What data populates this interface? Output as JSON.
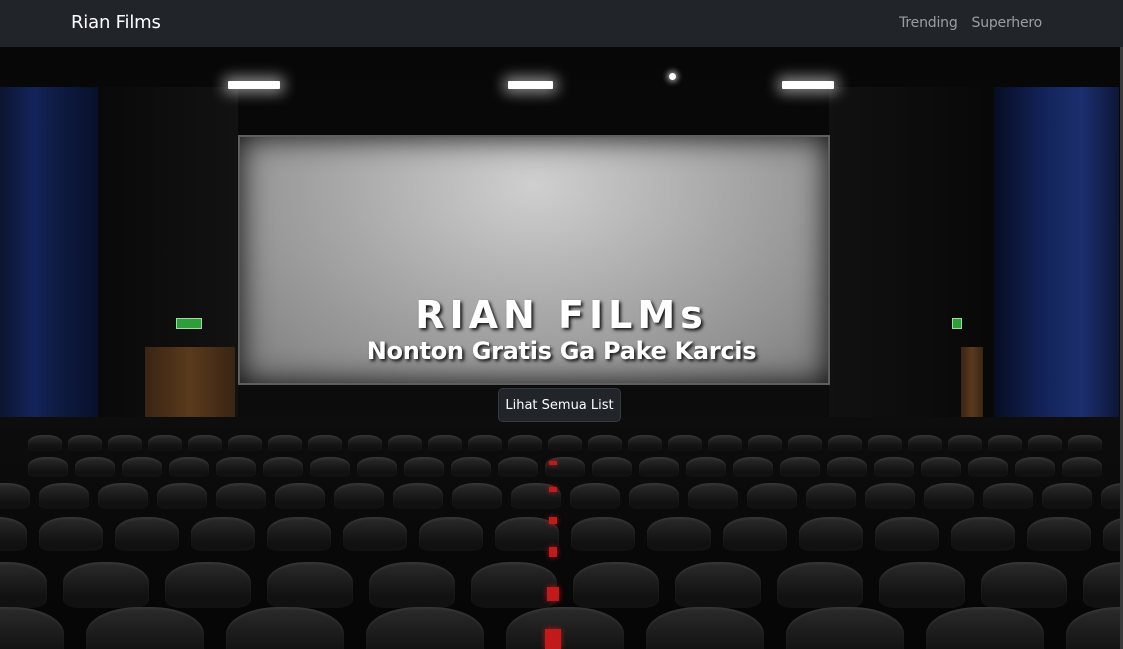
{
  "navbar": {
    "brand": "Rian Films",
    "links": [
      {
        "label": "Trending"
      },
      {
        "label": "Superhero"
      }
    ]
  },
  "hero": {
    "title": "RIAN FILMs",
    "subtitle": "Nonton Gratis Ga Pake Karcis",
    "button_label": "Lihat Semua List",
    "background_image": "cinema-theater-photo"
  },
  "colors": {
    "navbar_bg": "#212529",
    "nav_link": "#8c8f93",
    "button_bg": "#212529",
    "text": "#ffffff"
  }
}
